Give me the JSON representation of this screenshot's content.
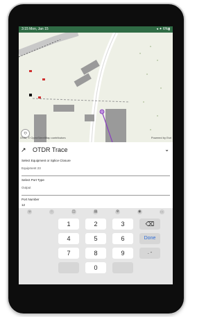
{
  "status_bar": {
    "time": "3:15  Mon, Jan 15",
    "icons": "◂ ✦ 6%▮"
  },
  "map": {
    "attribution": "OSM, © OpenStreetMap contributors",
    "powered_by": "Powered by Esri"
  },
  "panel": {
    "title": "OTDR Trace",
    "fields": [
      {
        "label": "Select Equipment or Splice Closure",
        "value": "Equipment 23"
      },
      {
        "label": "Select Port Type",
        "value": "Output"
      },
      {
        "label": "Port Number",
        "value": "12"
      }
    ]
  },
  "keyboard": {
    "toolbar_icons": [
      "emoji-icon",
      "sticker-icon",
      "gif-icon",
      "clipboard-icon",
      "settings-icon",
      "palette-icon",
      "more-icon"
    ],
    "keys": [
      "1",
      "2",
      "3",
      "4",
      "5",
      "6",
      "7",
      "8",
      "9",
      "0"
    ],
    "backspace": "⌫",
    "done": "Done",
    "punct": ". -"
  },
  "colors": {
    "accent": "#2f6b45",
    "keyboard_bg": "#e6e6e6",
    "done_blue": "#2a6ad6"
  }
}
